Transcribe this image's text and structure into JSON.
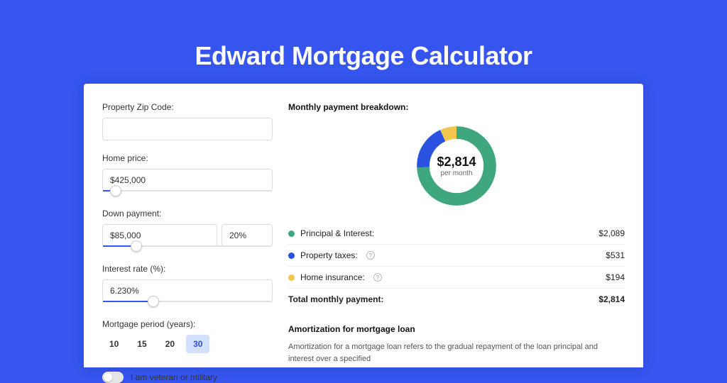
{
  "title": "Edward Mortgage Calculator",
  "colors": {
    "accent": "#3555ee",
    "principal": "#3fa77e",
    "taxes": "#2a52e0",
    "insurance": "#f3c74e"
  },
  "form": {
    "zip_label": "Property Zip Code:",
    "zip_value": "",
    "price_label": "Home price:",
    "price_value": "$425,000",
    "price_slider_pct": 8,
    "dp_label": "Down payment:",
    "dp_amount": "$85,000",
    "dp_pct": "20%",
    "dp_slider_pct": 20,
    "rate_label": "Interest rate (%):",
    "rate_value": "6.230%",
    "rate_slider_pct": 30,
    "period_label": "Mortgage period (years):",
    "periods": [
      "10",
      "15",
      "20",
      "30"
    ],
    "period_selected": "30",
    "veteran_label": "I am veteran or military",
    "veteran_on": false
  },
  "breakdown": {
    "title": "Monthly payment breakdown:",
    "center_amount": "$2,814",
    "center_sub": "per month",
    "rows": [
      {
        "label": "Principal & Interest:",
        "value": "$2,089",
        "color": "#3fa77e",
        "info": false
      },
      {
        "label": "Property taxes:",
        "value": "$531",
        "color": "#2a52e0",
        "info": true
      },
      {
        "label": "Home insurance:",
        "value": "$194",
        "color": "#f3c74e",
        "info": true
      }
    ],
    "total_label": "Total monthly payment:",
    "total_value": "$2,814"
  },
  "chart_data": {
    "type": "pie",
    "title": "Monthly payment breakdown",
    "series": [
      {
        "name": "Principal & Interest",
        "value": 2089
      },
      {
        "name": "Property taxes",
        "value": 531
      },
      {
        "name": "Home insurance",
        "value": 194
      }
    ],
    "total": 2814
  },
  "amort": {
    "title": "Amortization for mortgage loan",
    "text": "Amortization for a mortgage loan refers to the gradual repayment of the loan principal and interest over a specified"
  }
}
